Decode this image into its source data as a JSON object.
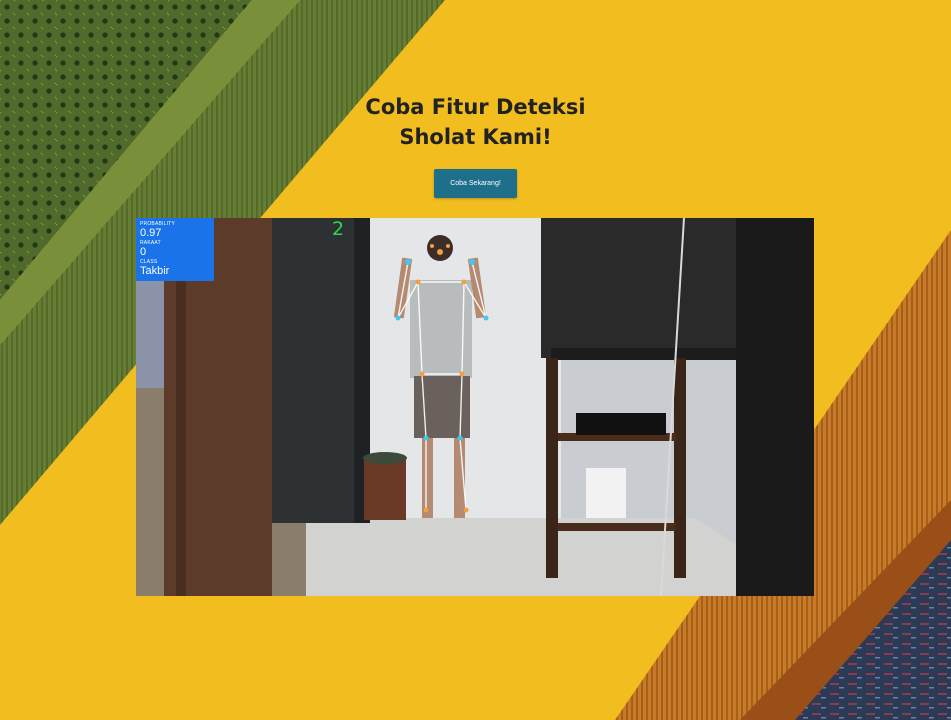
{
  "hero": {
    "title_line1": "Coba Fitur Deteksi",
    "title_line2": "Sholat Kami!",
    "cta_label": "Coba Sekarang!"
  },
  "detection": {
    "probability_label": "PROBABILITY",
    "probability_value": "0.97",
    "rakaat_label": "RAKAAT",
    "rakaat_value": "0",
    "class_label": "CLASS",
    "class_value": "Takbir",
    "frame_counter": "2"
  },
  "colors": {
    "background": "#f1bd1f",
    "cta": "#1d6f8a",
    "overlay": "#1a73e8",
    "counter": "#2bd94a"
  }
}
